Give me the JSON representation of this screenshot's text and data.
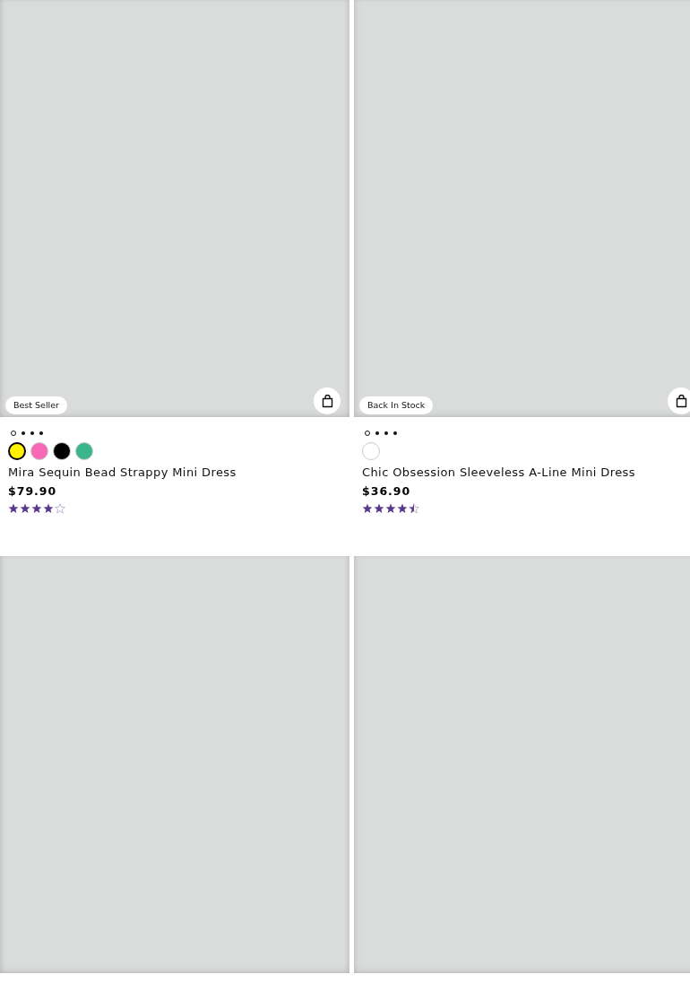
{
  "products": [
    {
      "kind": "full",
      "badge": "Best Seller",
      "slides": [
        {
          "selected": true
        },
        {
          "selected": false
        },
        {
          "selected": false
        },
        {
          "selected": false
        }
      ],
      "swatches": [
        {
          "color": "#fff200",
          "selected": true
        },
        {
          "color": "#f769b5",
          "selected": false
        },
        {
          "color": "#000000",
          "selected": false
        },
        {
          "color": "#3bb58a",
          "selected": false
        }
      ],
      "name": "Mira Sequin Bead Strappy Mini Dress",
      "price": "$79.90",
      "stars": 4
    },
    {
      "kind": "full",
      "badge": "Back In Stock",
      "slides": [
        {
          "selected": true
        },
        {
          "selected": false
        },
        {
          "selected": false
        },
        {
          "selected": false
        }
      ],
      "swatches": [
        {
          "color": "#ffffff",
          "selected": false
        }
      ],
      "name": "Chic Obsession Sleeveless A-Line Mini Dress",
      "price": "$36.90",
      "stars": 4.5
    },
    {
      "kind": "image-only"
    },
    {
      "kind": "image-only"
    }
  ]
}
